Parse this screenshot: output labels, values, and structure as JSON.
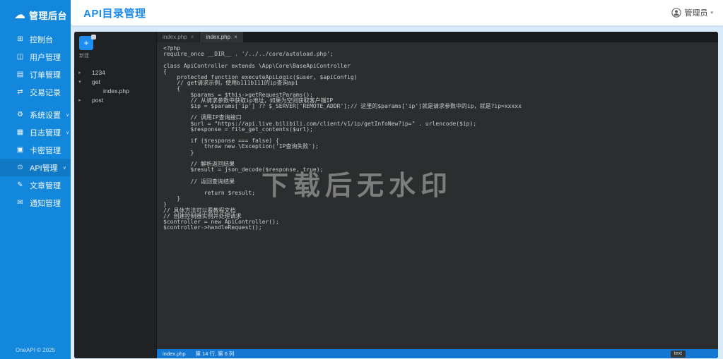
{
  "icons": {
    "chevron": "∨",
    "caret": "▾",
    "cloud": "☁",
    "close": "×",
    "plus": "+"
  },
  "colors": {
    "sidebar_blue": "#1287dc",
    "title_blue": "#1d8ce8",
    "statusbar_blue": "#1478d2",
    "editor_dark": "#2b2d2e"
  },
  "sidebar": {
    "logo_title": "管理后台",
    "items": [
      {
        "id": "dashboard",
        "label": "控制台",
        "icon": "⊞",
        "chevron": false,
        "active": false,
        "gap": false
      },
      {
        "id": "users",
        "label": "用户管理",
        "icon": "◫",
        "chevron": false,
        "active": false,
        "gap": false
      },
      {
        "id": "orders",
        "label": "订单管理",
        "icon": "▤",
        "chevron": false,
        "active": false,
        "gap": false
      },
      {
        "id": "transactions",
        "label": "交易记录",
        "icon": "⇄",
        "chevron": false,
        "active": false,
        "gap": false
      },
      {
        "id": "settings",
        "label": "系统设置",
        "icon": "⚙",
        "chevron": true,
        "active": false,
        "gap": true
      },
      {
        "id": "logs",
        "label": "日志管理",
        "icon": "▦",
        "chevron": true,
        "active": false,
        "gap": false
      },
      {
        "id": "cards",
        "label": "卡密管理",
        "icon": "▣",
        "chevron": false,
        "active": false,
        "gap": false
      },
      {
        "id": "api",
        "label": "API管理",
        "icon": "⊙",
        "chevron": true,
        "active": true,
        "gap": false
      },
      {
        "id": "articles",
        "label": "文章管理",
        "icon": "✎",
        "chevron": false,
        "active": false,
        "gap": false
      },
      {
        "id": "notifications",
        "label": "通知管理",
        "icon": "✉",
        "chevron": false,
        "active": false,
        "gap": false
      }
    ],
    "footer": "OneAPI © 2025"
  },
  "header": {
    "title": "API目录管理",
    "user_name": "管理员"
  },
  "editor": {
    "tree": {
      "new_caption": "新建",
      "nodes": [
        {
          "arrow": "▸",
          "label": "1234",
          "depth": 0
        },
        {
          "arrow": "▾",
          "label": "get",
          "depth": 0
        },
        {
          "arrow": "",
          "label": "index.php",
          "depth": 1
        },
        {
          "arrow": "▸",
          "label": "post",
          "depth": 0
        }
      ]
    },
    "tabs": [
      {
        "label": "index.php",
        "close": "×",
        "active": false
      },
      {
        "label": "index.php",
        "close": "×",
        "active": true
      }
    ],
    "code_lines": [
      "<?php",
      "require_once __DIR__ . '/../../core/autoload.php';",
      "",
      "class ApiController extends \\App\\Core\\BaseApiController",
      "{",
      "    protected function executeApiLogic($user, $apiConfig)",
      "    // get请求示例，使用b111b111的ip查询api",
      "    {",
      "        $params = $this->getRequestParams();",
      "        // 从请求参数中获取ip地址，如果为空则获取客户端IP",
      "        $ip = $params['ip'] ?? $_SERVER['REMOTE_ADDR'];// 这里的$params['ip']就是请求参数中的ip，就是?ip=xxxxx",
      "",
      "        // 调用IP查询接口",
      "        $url = \"https://api.live.bilibili.com/client/v1/ip/getInfoNew?ip=\" . urlencode($ip);",
      "        $response = file_get_contents($url);",
      "",
      "        if ($response === false) {",
      "            throw new \\Exception('IP查询失败');",
      "        }",
      "",
      "        // 解析返回结果",
      "        $result = json_decode($response, true);",
      "",
      "        // 返回查询结果",
      "",
      "            return $result;",
      "    }",
      "}",
      "// 具体方法可以看教程文档",
      "// 创建控制器实例并处理请求",
      "$controller = new ApiController();",
      "$controller->handleRequest();"
    ],
    "watermark": "下载后无水印",
    "statusbar": {
      "file": "index.php",
      "position": "第 14 行, 第 6 列",
      "mode": "text"
    }
  }
}
